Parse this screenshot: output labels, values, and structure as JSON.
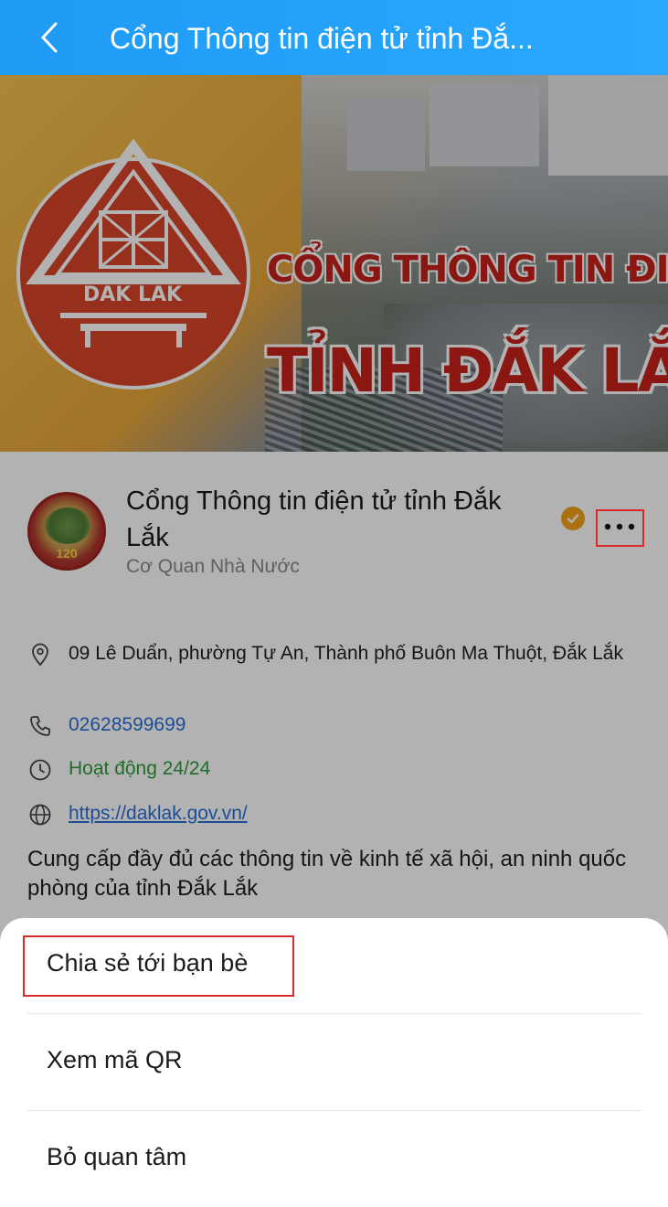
{
  "header": {
    "title": "Cổng Thông tin điện tử tỉnh Đắ..."
  },
  "banner": {
    "line1": "CỔNG THÔNG TIN ĐIỆN TỬ",
    "line2": "TỈNH ĐẮK LẮK",
    "logo_text": "DAK LAK"
  },
  "profile": {
    "name": "Cổng Thông tin điện tử tỉnh Đắk Lắk",
    "type": "Cơ Quan Nhà Nước",
    "avatar_text": "120"
  },
  "contact": {
    "address": "09 Lê Duẩn, phường Tự An, Thành phố Buôn Ma Thuột, Đắk Lắk",
    "phone": "02628599699",
    "hours": "Hoạt động 24/24",
    "website": "https://daklak.gov.vn/"
  },
  "description": "Cung cấp đầy đủ các thông tin về kinh tế xã hội, an ninh quốc phòng của tỉnh Đắk Lắk",
  "sheet": {
    "items": [
      {
        "label": "Chia sẻ tới bạn bè"
      },
      {
        "label": "Xem mã QR"
      },
      {
        "label": "Bỏ quan tâm"
      }
    ]
  },
  "colors": {
    "header": "#2aa8ff",
    "link": "#2a6fd6",
    "status_green": "#2d9c3c",
    "verified": "#f2a21b",
    "highlight": "#d92b2b"
  }
}
